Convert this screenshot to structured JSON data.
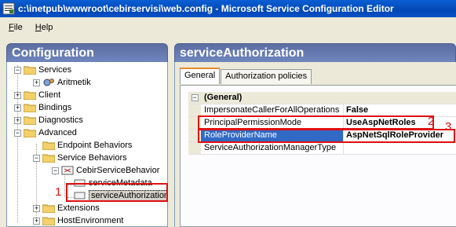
{
  "window": {
    "title": "c:\\inetpub\\wwwroot\\cebirservisi\\web.config - Microsoft Service Configuration Editor"
  },
  "menu": {
    "items": [
      {
        "label": "File",
        "accel": "F",
        "rest": "ile"
      },
      {
        "label": "Help",
        "accel": "H",
        "rest": "elp"
      }
    ]
  },
  "left_pane": {
    "header": "Configuration",
    "tree": [
      {
        "label": "Services",
        "level": 0,
        "expander": "−"
      },
      {
        "label": "Aritmetik",
        "level": 1,
        "expander": "+"
      },
      {
        "label": "Client",
        "level": 0,
        "expander": "+"
      },
      {
        "label": "Bindings",
        "level": 0,
        "expander": "+"
      },
      {
        "label": "Diagnostics",
        "level": 0,
        "expander": "+"
      },
      {
        "label": "Advanced",
        "level": 0,
        "expander": "−"
      },
      {
        "label": "Endpoint Behaviors",
        "level": 1,
        "expander": ""
      },
      {
        "label": "Service Behaviors",
        "level": 1,
        "expander": "−"
      },
      {
        "label": "CebirServiceBehavior",
        "level": 2,
        "expander": "−"
      },
      {
        "label": "serviceMetadata",
        "level": 3,
        "expander": ""
      },
      {
        "label": "serviceAuthorization",
        "level": 3,
        "expander": "",
        "selected": true
      },
      {
        "label": "Extensions",
        "level": 1,
        "expander": "+"
      },
      {
        "label": "HostEnvironment",
        "level": 1,
        "expander": "+"
      }
    ]
  },
  "right_pane": {
    "header": "serviceAuthorization",
    "tabs": [
      {
        "label": "General",
        "active": true
      },
      {
        "label": "Authorization policies",
        "active": false
      }
    ],
    "grid": {
      "category": "(General)",
      "rows": [
        {
          "name": "ImpersonateCallerForAllOperations",
          "value": "False"
        },
        {
          "name": "PrincipalPermissionMode",
          "value": "UseAspNetRoles"
        },
        {
          "name": "RoleProviderName",
          "value": "AspNetSqlRoleProvider",
          "selected": true
        },
        {
          "name": "ServiceAuthorizationManagerType",
          "value": ""
        }
      ]
    }
  },
  "annotations": [
    {
      "number": "1"
    },
    {
      "number": "2"
    },
    {
      "number": "3"
    }
  ],
  "colors": {
    "title_bar": "#0347b5",
    "pane_header": "#6479b0",
    "annotation": "#e01010",
    "selection": "#316ac5"
  }
}
